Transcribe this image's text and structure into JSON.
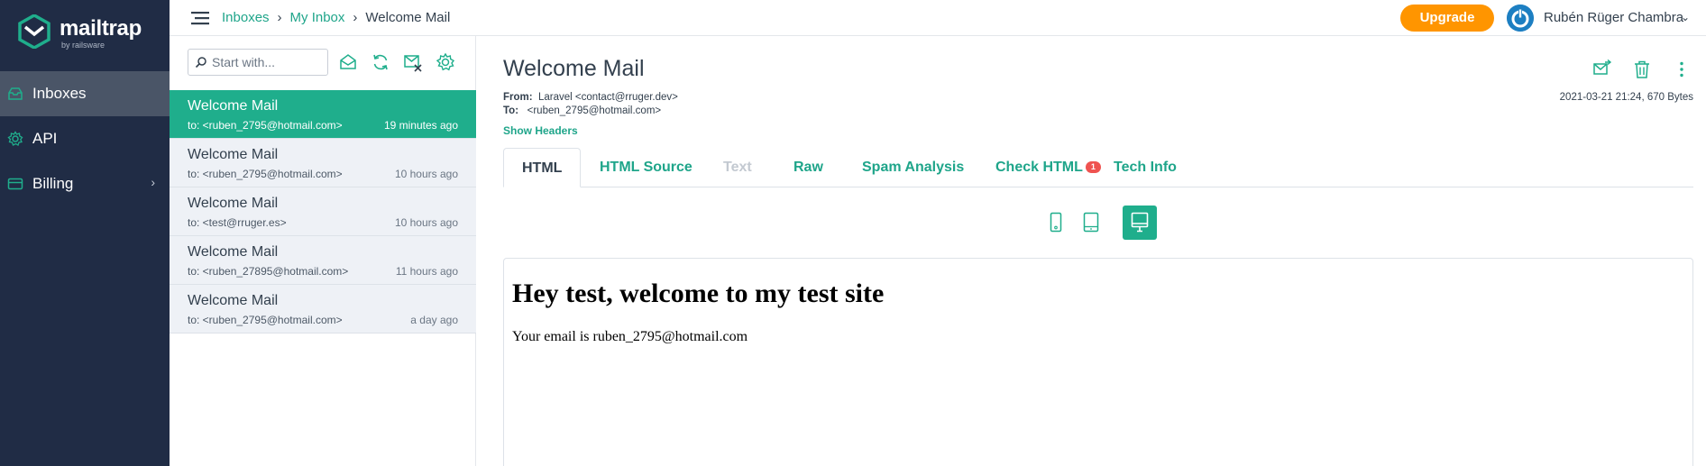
{
  "brand": {
    "name": "mailtrap",
    "sub": "by railsware",
    "accent": "#1fae8c",
    "sidebar_bg": "#202c45"
  },
  "sidebar": {
    "items": [
      {
        "label": "Inboxes",
        "icon": "inbox-icon",
        "active": true
      },
      {
        "label": "API",
        "icon": "gear-icon"
      },
      {
        "label": "Billing",
        "icon": "card-icon",
        "chevron": "›"
      }
    ]
  },
  "topbar": {
    "breadcrumb": {
      "root": "Inboxes",
      "sep": "›",
      "inbox": "My Inbox",
      "current": "Welcome Mail"
    },
    "upgrade_label": "Upgrade",
    "user_name": "Rubén Rüger Chambra",
    "user_chevron": "⌄"
  },
  "list": {
    "search_placeholder": "Start with...",
    "messages": [
      {
        "subject": "Welcome Mail",
        "to": "to: <ruben_2795@hotmail.com>",
        "time": "19 minutes ago"
      },
      {
        "subject": "Welcome Mail",
        "to": "to: <ruben_2795@hotmail.com>",
        "time": "10 hours ago"
      },
      {
        "subject": "Welcome Mail",
        "to": "to: <test@rruger.es>",
        "time": "10 hours ago"
      },
      {
        "subject": "Welcome Mail",
        "to": "to: <ruben_27895@hotmail.com>",
        "time": "11 hours ago"
      },
      {
        "subject": "Welcome Mail",
        "to": "to: <ruben_2795@hotmail.com>",
        "time": "a day ago"
      }
    ]
  },
  "mail": {
    "title": "Welcome Mail",
    "from_label": "From:",
    "from_value": "Laravel <contact@rruger.dev>",
    "to_label": "To:",
    "to_value": "<ruben_2795@hotmail.com>",
    "show_headers": "Show Headers",
    "date_size": "2021-03-21 21:24, 670 Bytes",
    "tabs": [
      {
        "label": "HTML",
        "state": "active"
      },
      {
        "label": "HTML Source"
      },
      {
        "label": "Text",
        "state": "disabled"
      },
      {
        "label": "Raw"
      },
      {
        "label": "Spam Analysis"
      },
      {
        "label": "Check HTML",
        "badge": "1"
      },
      {
        "label": "Tech Info"
      }
    ],
    "preview": {
      "heading": "Hey test, welcome to my test site",
      "body": "Your email is ruben_2795@hotmail.com"
    }
  }
}
